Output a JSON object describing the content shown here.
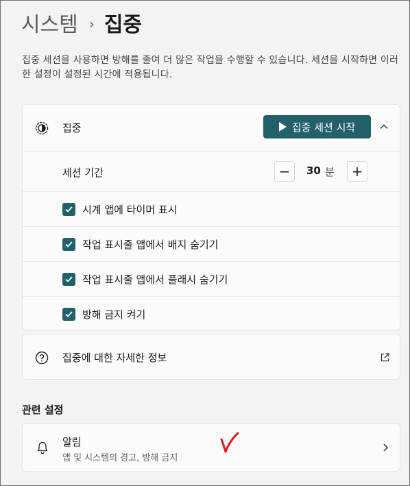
{
  "breadcrumb": {
    "parent": "시스템",
    "separator": "›",
    "current": "집중"
  },
  "description": "집중 세션을 사용하면 방해를 줄여 더 많은 작업을 수행할 수 있습니다. 세션을 시작하면 이러한 설정이 설정된 시간에 적용됩니다.",
  "focus": {
    "icon": "focus-icon",
    "title": "집중",
    "start_label": "집중 세션 시작",
    "duration_label": "세션 기간",
    "duration_value": "30",
    "duration_unit": "분",
    "minus": "−",
    "plus": "+",
    "options": [
      {
        "label": "시계 앱에 타이머 표시",
        "checked": true
      },
      {
        "label": "작업 표시줄 앱에서 배지 숨기기",
        "checked": true
      },
      {
        "label": "작업 표시줄 앱에서 플래시 숨기기",
        "checked": true
      },
      {
        "label": "방해 금지 켜기",
        "checked": true
      }
    ]
  },
  "info": {
    "icon": "help-icon",
    "label": "집중에 대한 자세한 정보"
  },
  "related": {
    "title": "관련 설정",
    "notifications": {
      "title": "알림",
      "subtitle": "앱 및 시스템의 경고, 방해 금지",
      "icon": "bell-icon"
    }
  },
  "colors": {
    "accent": "#22606a",
    "background": "#f3f3f3",
    "annotation": "#e0161b"
  }
}
